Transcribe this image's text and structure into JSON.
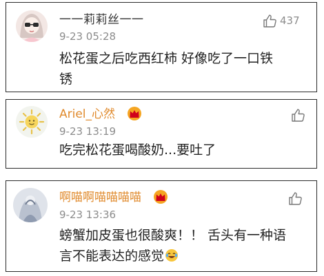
{
  "comments": [
    {
      "username": "一一莉莉丝一一",
      "time": "9-23 05:28",
      "like_count": "437",
      "text_lines": [
        "松花蛋之后吃西红柿 好像吃了一口铁",
        "锈"
      ],
      "vip": false
    },
    {
      "username": "Ariel_心然",
      "time": "9-23 13:19",
      "like_count": "",
      "text_lines": [
        "吃完松花蛋喝酸奶...要吐了"
      ],
      "vip": true
    },
    {
      "username": "啊喵啊喵喵喵喵",
      "time": "9-23 13:36",
      "like_count": "",
      "text_lines": [
        "螃蟹加皮蛋也很酸爽！！ 舌头有一种语",
        "言不能表达的感觉"
      ],
      "vip": true
    }
  ],
  "icons": {
    "like": "thumbs-up-icon",
    "vip": "crown-icon",
    "emoji": "laughing-crying-emoji-icon"
  },
  "colors": {
    "vip_name": "#e08a2c",
    "text": "#222222",
    "meta": "#8c8c8c",
    "border": "#2a2a2a"
  }
}
